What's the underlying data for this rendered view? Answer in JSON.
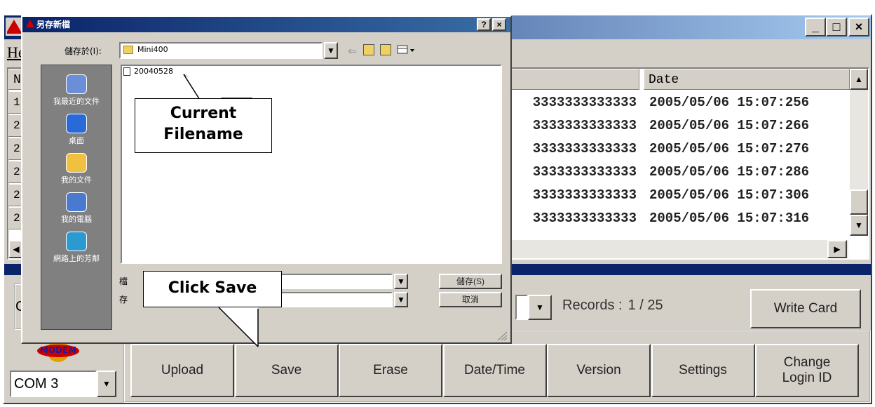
{
  "window": {
    "min_glyph": "_",
    "max_glyph": "□",
    "close_glyph": "×",
    "menu_help": "He"
  },
  "grid": {
    "col_no": "Nc",
    "col_date": "Date",
    "rows": [
      {
        "no": "1",
        "data": "3333333333333",
        "date": "2005/05/06 15:07:256"
      },
      {
        "no": "2",
        "data": "3333333333333",
        "date": "2005/05/06 15:07:266"
      },
      {
        "no": "2",
        "data": "3333333333333",
        "date": "2005/05/06 15:07:276"
      },
      {
        "no": "2",
        "data": "3333333333333",
        "date": "2005/05/06 15:07:286"
      },
      {
        "no": "2",
        "data": "3333333333333",
        "date": "2005/05/06 15:07:306"
      },
      {
        "no": "2",
        "data": "3333333333333",
        "date": "2005/05/06 15:07:316"
      }
    ]
  },
  "bottom": {
    "group_label_fragment": "C",
    "records_label": "Records :",
    "records_value": "1 / 25",
    "write_card": "Write Card",
    "modem_label": "MODEM",
    "com_port": "COM 3",
    "buttons": [
      "Upload",
      "Save",
      "Erase",
      "Date/Time",
      "Version",
      "Settings",
      "Change Login ID"
    ]
  },
  "dialog": {
    "title": "另存新檔",
    "help_glyph": "?",
    "close_glyph": "×",
    "save_in_label": "儲存於(I):",
    "save_in_value": "Mini400",
    "places": [
      "我最近的文件",
      "桌面",
      "我的文件",
      "我的電腦",
      "網路上的芳鄰"
    ],
    "file_item": "20040528",
    "filename_label_fragment": "檔",
    "filetype_label_fragment": "存",
    "save_button": "儲存(S)",
    "cancel_button": "取消"
  },
  "callouts": {
    "current_filename": "Current Filename",
    "click_save": "Click Save"
  },
  "colors": {
    "title_blue": "#0a246a",
    "face": "#d4d0c8"
  }
}
